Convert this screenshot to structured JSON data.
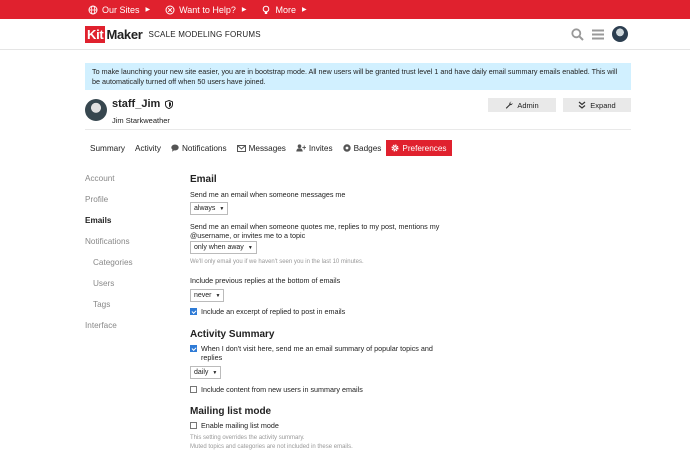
{
  "topbar": {
    "items": [
      {
        "label": "Our Sites",
        "icon": "globe-icon"
      },
      {
        "label": "Want to Help?",
        "icon": "circle-x-icon"
      },
      {
        "label": "More",
        "icon": "lightbulb-icon"
      }
    ]
  },
  "header": {
    "logo_kit": "Kit",
    "logo_maker": "Maker",
    "tagline": "SCALE MODELING FORUMS"
  },
  "banner": {
    "text": "To make launching your new site easier, you are in bootstrap mode. All new users will be granted trust level 1 and have daily email summary emails enabled. This will be automatically turned off when 50 users have joined."
  },
  "profile": {
    "username": "staff_Jim",
    "real_name": "Jim Starkweather",
    "admin_label": "Admin",
    "expand_label": "Expand"
  },
  "tabs": [
    {
      "label": "Summary"
    },
    {
      "label": "Activity"
    },
    {
      "label": "Notifications"
    },
    {
      "label": "Messages"
    },
    {
      "label": "Invites"
    },
    {
      "label": "Badges"
    },
    {
      "label": "Preferences"
    }
  ],
  "sidenav": [
    {
      "label": "Account"
    },
    {
      "label": "Profile"
    },
    {
      "label": "Emails"
    },
    {
      "label": "Notifications"
    },
    {
      "label": "Categories"
    },
    {
      "label": "Users"
    },
    {
      "label": "Tags"
    },
    {
      "label": "Interface"
    }
  ],
  "email": {
    "title": "Email",
    "messages_label": "Send me an email when someone messages me",
    "messages_value": "always",
    "quotes_label": "Send me an email when someone quotes me, replies to my post, mentions my @username, or invites me to a topic",
    "quotes_value": "only when away",
    "quotes_hint": "We'll only email you if we haven't seen you in the last 10 minutes.",
    "previous_label": "Include previous replies at the bottom of emails",
    "previous_value": "never",
    "excerpt_label": "Include an excerpt of replied to post in emails"
  },
  "activity": {
    "title": "Activity Summary",
    "summary_label": "When I don't visit here, send me an email summary of popular topics and replies",
    "summary_value": "daily",
    "new_users_label": "Include content from new users in summary emails"
  },
  "mailing": {
    "title": "Mailing list mode",
    "enable_label": "Enable mailing list mode",
    "hint1": "This setting overrides the activity summary.",
    "hint2": "Muted topics and categories are not included in these emails."
  },
  "colors": {
    "brand_red": "#e0212e",
    "banner_blue": "#d1f0ff",
    "checkbox_blue": "#2f7bd6"
  }
}
